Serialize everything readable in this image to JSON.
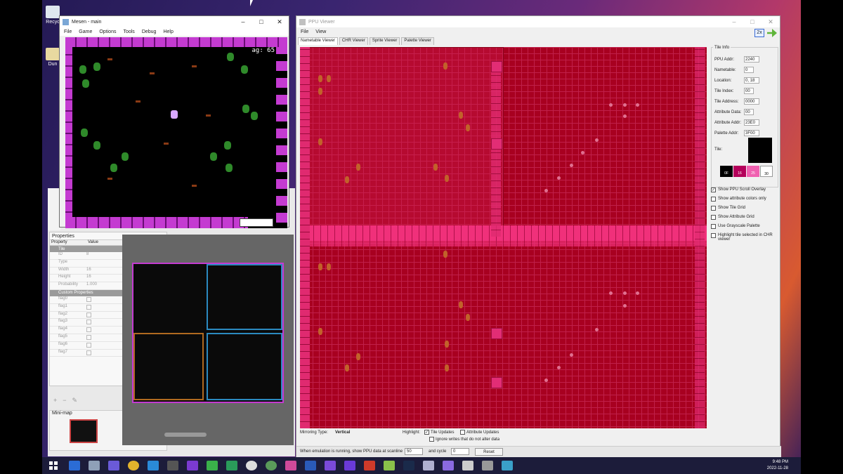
{
  "desktop": {
    "icons": [
      {
        "label": "Recyc"
      },
      {
        "label": "Dun"
      }
    ]
  },
  "mesen": {
    "title": "Mesen - main",
    "menu": [
      "File",
      "Game",
      "Options",
      "Tools",
      "Debug",
      "Help"
    ],
    "hud_text": "ag: 65"
  },
  "tiled": {
    "properties_title": "Properties",
    "columns": [
      "Property",
      "Value"
    ],
    "section_tile": "Tile",
    "rows": [
      {
        "k": "ID",
        "v": "8"
      },
      {
        "k": "Type",
        "v": ""
      },
      {
        "k": "Width",
        "v": "16"
      },
      {
        "k": "Height",
        "v": "16"
      },
      {
        "k": "Probability",
        "v": "1.000"
      }
    ],
    "section_custom": "Custom Properties",
    "flags": [
      "flag0",
      "flag1",
      "flag2",
      "flag3",
      "flag4",
      "flag5",
      "flag6",
      "flag7"
    ],
    "minimap_title": "Mini-map"
  },
  "ppu": {
    "title": "PPU Viewer",
    "menu": [
      "File",
      "View"
    ],
    "tabs": [
      "Nametable Viewer",
      "CHR Viewer",
      "Sprite Viewer",
      "Palette Viewer"
    ],
    "zoom": "2x",
    "tile_info": {
      "legend": "Tile Info",
      "fields": [
        {
          "label": "PPU Addr:",
          "value": "2240"
        },
        {
          "label": "Nametable:",
          "value": "0"
        },
        {
          "label": "Location:",
          "value": "0, 18"
        },
        {
          "label": "Tile Index:",
          "value": "00"
        },
        {
          "label": "Tile Address:",
          "value": "0000"
        },
        {
          "label": "Attribute Data:",
          "value": "00"
        },
        {
          "label": "Attribute Addr:",
          "value": "23E0"
        },
        {
          "label": "Palette Addr:",
          "value": "3F00"
        }
      ],
      "tile_label": "Tile:",
      "palette": [
        {
          "code": "0F",
          "color": "#000000"
        },
        {
          "code": "16",
          "color": "#b4005a"
        },
        {
          "code": "25",
          "color": "#f060b0"
        },
        {
          "code": "30",
          "color": "#ffffff"
        }
      ]
    },
    "options": [
      {
        "label": "Show PPU Scroll Overlay",
        "checked": true
      },
      {
        "label": "Show attribute colors only",
        "checked": false
      },
      {
        "label": "Show Tile Grid",
        "checked": false
      },
      {
        "label": "Show Attribute Grid",
        "checked": false
      },
      {
        "label": "Use Grayscale Palette",
        "checked": false
      },
      {
        "label": "Highlight tile selected in CHR viewer",
        "checked": false
      }
    ],
    "mirroring_label": "Mirroring Type:",
    "mirroring_value": "Vertical",
    "highlight_label": "Highlight:",
    "highlight_tile_updates": "Tile Updates",
    "highlight_attr_updates": "Attribute Updates",
    "ignore_writes": "Ignore writes that do not alter data",
    "refresh_text": "When emulation is running, show PPU data at scanline",
    "scanline": "50",
    "and_cycle": "and cycle",
    "cycle": "0",
    "reset": "Reset"
  },
  "taskbar": {
    "time": "9:48 PM",
    "date": "2022-11-28"
  }
}
